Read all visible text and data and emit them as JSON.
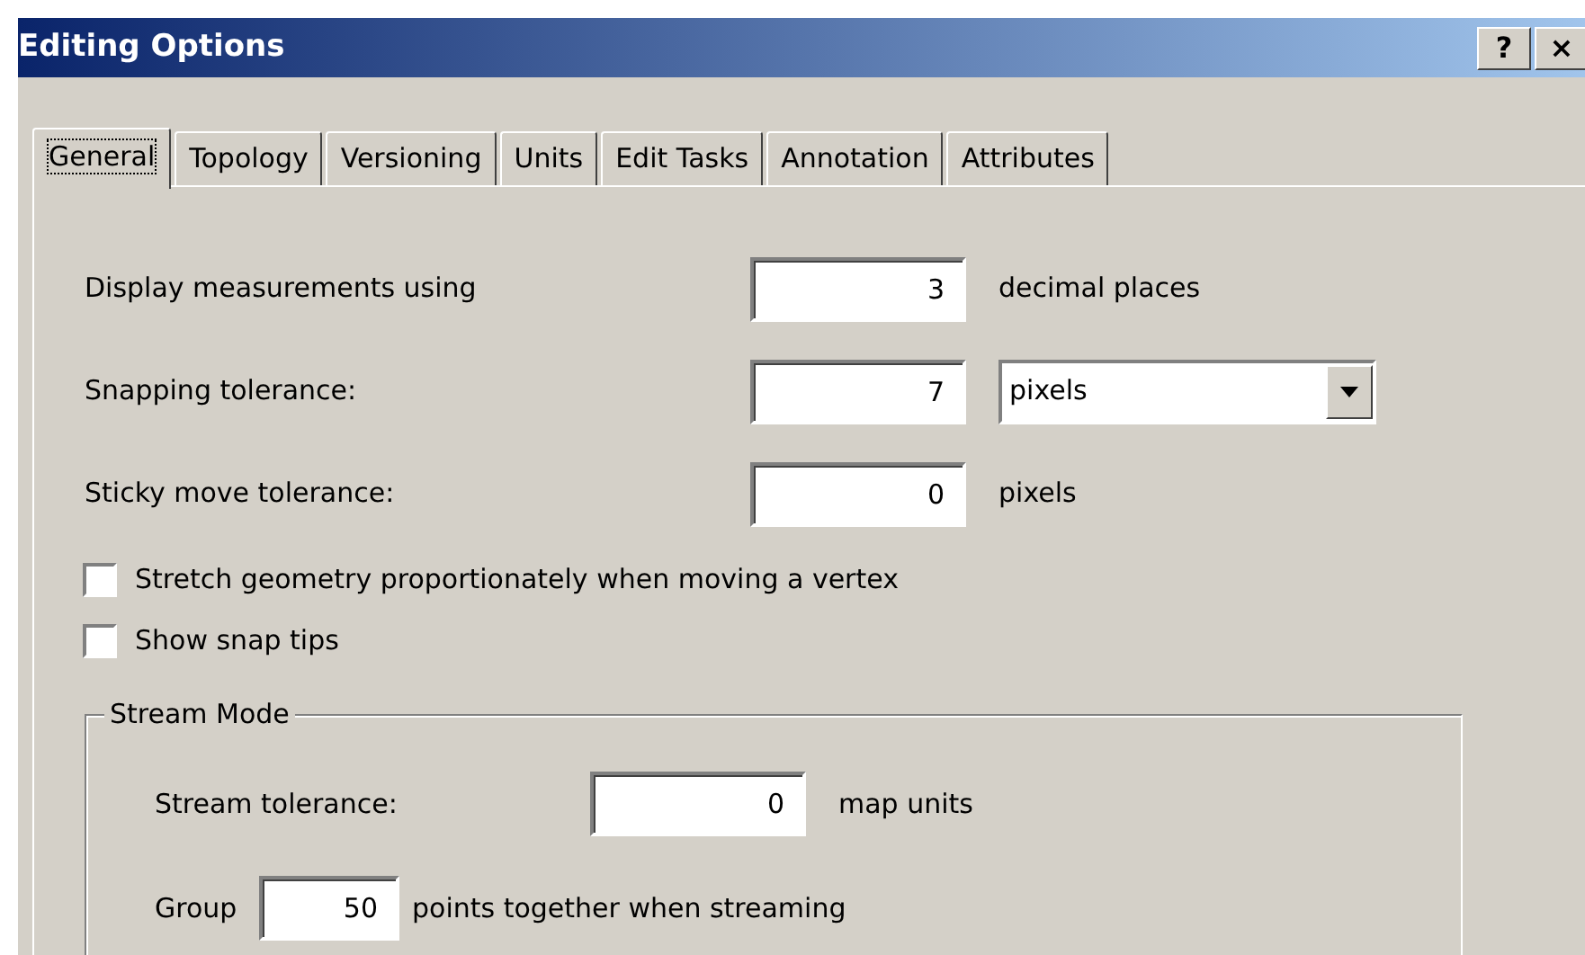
{
  "window": {
    "title": "Editing Options",
    "buttons": [
      "?",
      "×"
    ]
  },
  "tabs": [
    {
      "label": "General",
      "selected": true
    },
    {
      "label": "Topology",
      "selected": false
    },
    {
      "label": "Versioning",
      "selected": false
    },
    {
      "label": "Units",
      "selected": false
    },
    {
      "label": "Edit Tasks",
      "selected": false
    },
    {
      "label": "Annotation",
      "selected": false
    },
    {
      "label": "Attributes",
      "selected": false
    }
  ],
  "fields": [
    {
      "label": "Display measurements using",
      "value": "3",
      "suffix": "decimal places"
    },
    {
      "label": "Snapping tolerance:",
      "value": "7",
      "dropdown": "pixels"
    },
    {
      "label": "Sticky move tolerance:",
      "value": "0",
      "suffix": "pixels"
    }
  ],
  "checkboxes": [
    {
      "label": "Stretch geometry proportionately when moving a vertex",
      "checked": false
    },
    {
      "label": "Show snap tips",
      "checked": false
    }
  ],
  "stream_mode": {
    "title": "Stream Mode",
    "tolerance": {
      "label": "Stream tolerance:",
      "value": "0",
      "suffix": "map units"
    },
    "group": {
      "label": "Group",
      "value": "50",
      "suffix": "points together when streaming"
    }
  }
}
